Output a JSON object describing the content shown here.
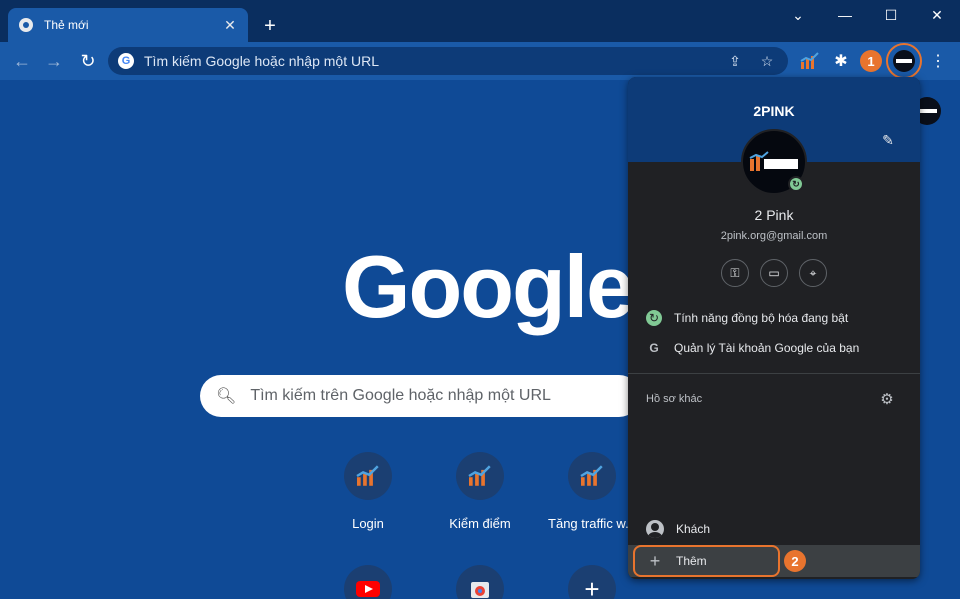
{
  "tab": {
    "title": "Thẻ mới",
    "close": "✕",
    "new": "+"
  },
  "window": {
    "minimize": "⌄",
    "maximize": "☐",
    "close": "✕",
    "restore": "—"
  },
  "omnibox": {
    "placeholder": "Tìm kiếm Google hoặc nhập một URL"
  },
  "ntp": {
    "logo": "Google",
    "search_placeholder": "Tìm kiếm trên Google hoặc nhập một URL",
    "tiles": [
      {
        "label": "Login",
        "icon": "chart-icon"
      },
      {
        "label": "Kiểm điểm",
        "icon": "chart-icon"
      },
      {
        "label": "Tăng traffic w...",
        "icon": "chart-icon"
      },
      {
        "label": "",
        "icon": "youtube-icon"
      },
      {
        "label": "",
        "icon": "chrome-web-store-icon"
      },
      {
        "label": "",
        "icon": "add-shortcut-icon"
      }
    ]
  },
  "profile_panel": {
    "header_name": "2PINK",
    "name": "2 Pink",
    "email": "2pink.org@gmail.com",
    "sync": "Tính năng đồng bộ hóa đang bật",
    "manage": "Quản lý Tài khoản Google của bạn",
    "other_profiles": "Hồ sơ khác",
    "guest": "Khách",
    "add": "Thêm"
  },
  "annotations": {
    "step1": "1",
    "step2": "2"
  },
  "colors": {
    "accent": "#e8742e",
    "toolbar": "#1a5aa8",
    "page": "#0f4a96",
    "panel": "#202124"
  }
}
